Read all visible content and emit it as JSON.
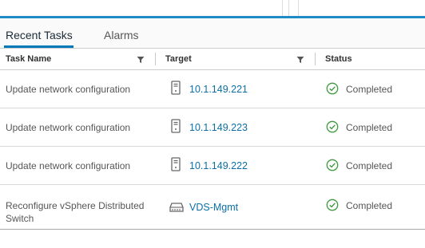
{
  "tabs": {
    "recent_tasks": "Recent Tasks",
    "alarms": "Alarms"
  },
  "columns": {
    "task_name": "Task Name",
    "target": "Target",
    "status": "Status"
  },
  "rows": [
    {
      "task": "Update network configuration",
      "target": "10.1.149.221",
      "target_icon": "host-icon",
      "status": "Completed",
      "status_icon": "check-circle-icon"
    },
    {
      "task": "Update network configuration",
      "target": "10.1.149.223",
      "target_icon": "host-icon",
      "status": "Completed",
      "status_icon": "check-circle-icon"
    },
    {
      "task": "Update network configuration",
      "target": "10.1.149.222",
      "target_icon": "host-icon",
      "status": "Completed",
      "status_icon": "check-circle-icon"
    },
    {
      "task": "Reconfigure vSphere Distributed Switch",
      "target": "VDS-Mgmt",
      "target_icon": "distributed-switch-icon",
      "status": "Completed",
      "status_icon": "check-circle-icon"
    }
  ],
  "colors": {
    "accent": "#0079b8",
    "link": "#0b6fa6",
    "success": "#3d9b3d"
  }
}
